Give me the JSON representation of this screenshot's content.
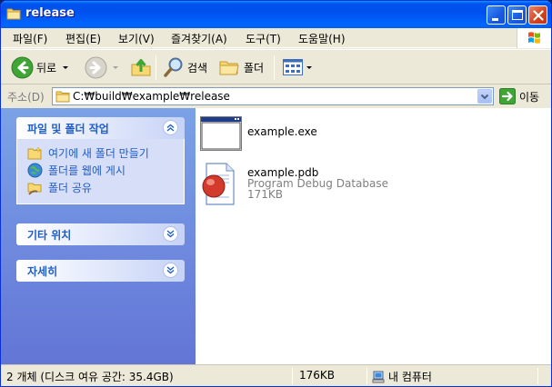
{
  "window": {
    "title": "release"
  },
  "menu": [
    "파일(F)",
    "편집(E)",
    "보기(V)",
    "즐겨찾기(A)",
    "도구(T)",
    "도움말(H)"
  ],
  "toolbar": {
    "back_label": "뒤로",
    "search_label": "검색",
    "folders_label": "폴더"
  },
  "address": {
    "label": "주소(D)",
    "path": "C:₩build₩example₩release",
    "go_label": "이동"
  },
  "tasks_panel": {
    "title": "파일 및 폴더 작업",
    "items": [
      {
        "label": "여기에 새 폴더 만들기",
        "icon": "new-folder-icon"
      },
      {
        "label": "폴더를 웹에 게시",
        "icon": "publish-web-icon"
      },
      {
        "label": "폴더 공유",
        "icon": "share-folder-icon"
      }
    ]
  },
  "other_places_panel": {
    "title": "기타 위치"
  },
  "details_panel": {
    "title": "자세히"
  },
  "files": [
    {
      "name": "example.exe",
      "icon": "exe-window-icon"
    },
    {
      "name": "example.pdb",
      "type": "Program Debug Database",
      "size": "171KB",
      "icon": "pdb-file-icon"
    }
  ],
  "status": {
    "objects": "2 개체 (디스크 여유 공간: 35.4GB)",
    "size": "176KB",
    "location": "내 컴퓨터"
  },
  "colors": {
    "title_bar": "#0053EE",
    "left_pane": "#6D8DE0",
    "task_text": "#215DC6"
  }
}
